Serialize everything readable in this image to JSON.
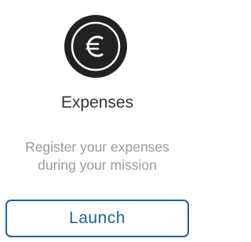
{
  "card": {
    "icon": "euro-icon",
    "title": "Expenses",
    "description_line1": "Register your expenses",
    "description_line2": "during your mission",
    "launch_label": "Launch"
  },
  "colors": {
    "icon_circle": "#222222",
    "title": "#333333",
    "description": "#9a9a9a",
    "accent": "#1e5fa6",
    "background": "#ffffff"
  }
}
